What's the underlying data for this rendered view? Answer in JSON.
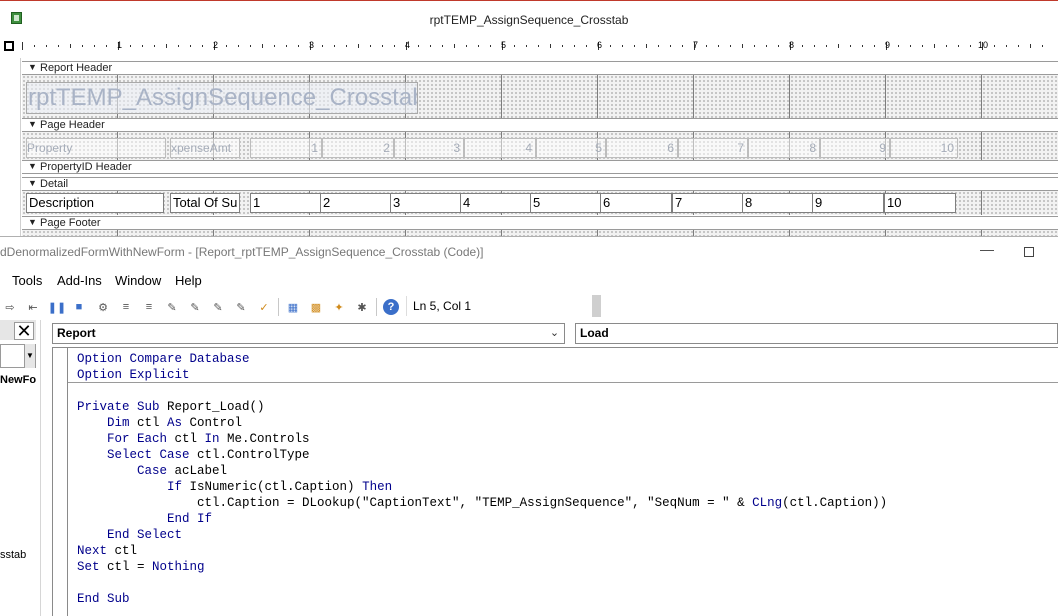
{
  "report": {
    "title": "rptTEMP_AssignSequence_Crosstab",
    "ruler_numbers": [
      "1",
      "2",
      "3",
      "4",
      "5",
      "6",
      "7",
      "8",
      "9",
      "10"
    ],
    "sections": {
      "report_header": "Report Header",
      "page_header": "Page Header",
      "group_header": "PropertyID Header",
      "detail": "Detail",
      "page_footer": "Page Footer"
    },
    "report_header_title": "rptTEMP_AssignSequence_Crosstab",
    "page_header_labels": [
      "Property",
      "xpenseAmt",
      "1",
      "2",
      "3",
      "4",
      "5",
      "6",
      "7",
      "8",
      "9",
      "10"
    ],
    "detail_fields": [
      "Description",
      "Total Of Su",
      "1",
      "2",
      "3",
      "4",
      "5",
      "6",
      "7",
      "8",
      "9",
      "10"
    ]
  },
  "vbe": {
    "title": "dDenormalizedFormWithNewForm - [Report_rptTEMP_AssignSequence_Crosstab (Code)]",
    "menu": [
      "Tools",
      "Add-Ins",
      "Window",
      "Help"
    ],
    "cursor_position": "Ln 5, Col 1",
    "project_items": [
      "NewFo",
      "sstab"
    ],
    "object_combo": "Report",
    "procedure_combo": "Load",
    "code": {
      "l1a": "Option",
      "l1b": " Compare Database",
      "l2": "Option Explicit",
      "l4a": "Private Sub",
      "l4b": " Report_Load()",
      "l5a": "    Dim",
      "l5b": " ctl ",
      "l5c": "As",
      "l5d": " Control",
      "l6a": "    For Each",
      "l6b": " ctl ",
      "l6c": "In",
      "l6d": " Me.Controls",
      "l7a": "    Select Case",
      "l7b": " ctl.ControlType",
      "l8a": "        Case",
      "l8b": " acLabel",
      "l9a": "            If",
      "l9b": " IsNumeric(ctl.Caption) ",
      "l9c": "Then",
      "l10a": "                ctl.Caption = DLookup(\"CaptionText\", \"TEMP_AssignSequence\", \"SeqNum = \" & ",
      "l10b": "CLng",
      "l10c": "(ctl.Caption))",
      "l11": "            End If",
      "l12": "    End Select",
      "l13a": "Next",
      "l13b": " ctl",
      "l14a": "Set",
      "l14b": " ctl = ",
      "l14c": "Nothing",
      "l16": "End Sub"
    }
  },
  "colors": {
    "keyword": "#00008b",
    "grid_dots": "#8c8c8c",
    "title_accent": "#c0392b"
  }
}
